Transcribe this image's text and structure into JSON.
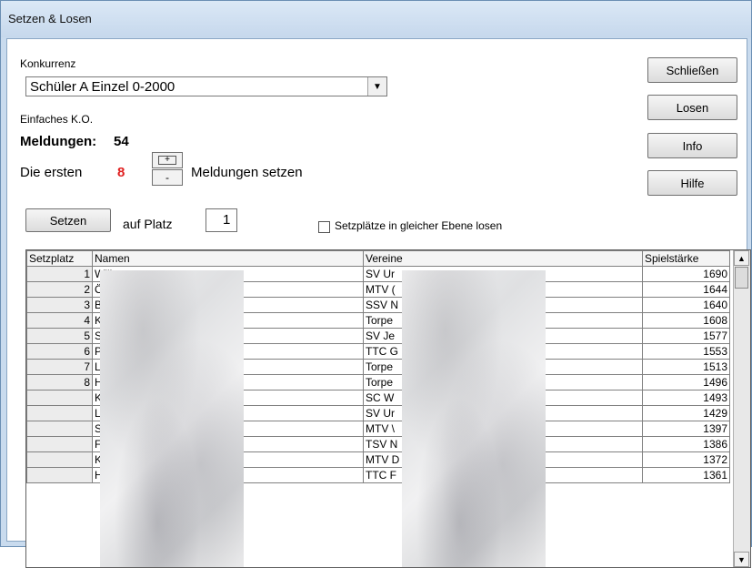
{
  "window": {
    "title": "Setzen & Losen"
  },
  "competition": {
    "label": "Konkurrenz",
    "selected": "Schüler A Einzel 0-2000",
    "mode": "Einfaches K.O.",
    "entries_label": "Meldungen:",
    "entries_count": "54"
  },
  "seeding": {
    "prefix": "Die ersten",
    "count": "8",
    "suffix": "Meldungen setzen",
    "plus": "+",
    "minus": "-"
  },
  "set_row": {
    "set_button": "Setzen",
    "place_label": "auf Platz",
    "place_value": "1",
    "checkbox_label": "Setzplätze in gleicher Ebene losen"
  },
  "buttons": {
    "close": "Schließen",
    "draw": "Losen",
    "info": "Info",
    "help": "Hilfe"
  },
  "table": {
    "headers": [
      "Setzplatz",
      "Namen",
      "Vereine",
      "Spielstärke"
    ],
    "rows": [
      {
        "seed": "1",
        "name": "Wilk",
        "club": "SV Ur",
        "strength": "1690"
      },
      {
        "seed": "2",
        "name": "Özd",
        "club": "MTV (",
        "strength": "1644"
      },
      {
        "seed": "3",
        "name": "Beli",
        "club": "SSV N",
        "strength": "1640"
      },
      {
        "seed": "4",
        "name": "Koc",
        "club": "Torpe",
        "strength": "1608"
      },
      {
        "seed": "5",
        "name": "Stoc",
        "club": "SV Je",
        "strength": "1577"
      },
      {
        "seed": "6",
        "name": "Pete",
        "club": "TTC G",
        "strength": "1553"
      },
      {
        "seed": "7",
        "name": "Len",
        "club": "Torpe",
        "strength": "1513"
      },
      {
        "seed": "8",
        "name": "Hag",
        "club": "Torpe",
        "strength": "1496"
      },
      {
        "seed": "",
        "name": "Koc",
        "club": "SC W",
        "strength": "1493"
      },
      {
        "seed": "",
        "name": "Lan",
        "club": "SV Ur",
        "strength": "1429"
      },
      {
        "seed": "",
        "name": "Stru",
        "club": "MTV \\",
        "strength": "1397"
      },
      {
        "seed": "",
        "name": "Flac",
        "club": "TSV N",
        "strength": "1386"
      },
      {
        "seed": "",
        "name": "Klar",
        "club": "MTV D",
        "strength": "1372"
      },
      {
        "seed": "",
        "name": "Hage",
        "club": "TTC F",
        "strength": "1361"
      }
    ]
  }
}
